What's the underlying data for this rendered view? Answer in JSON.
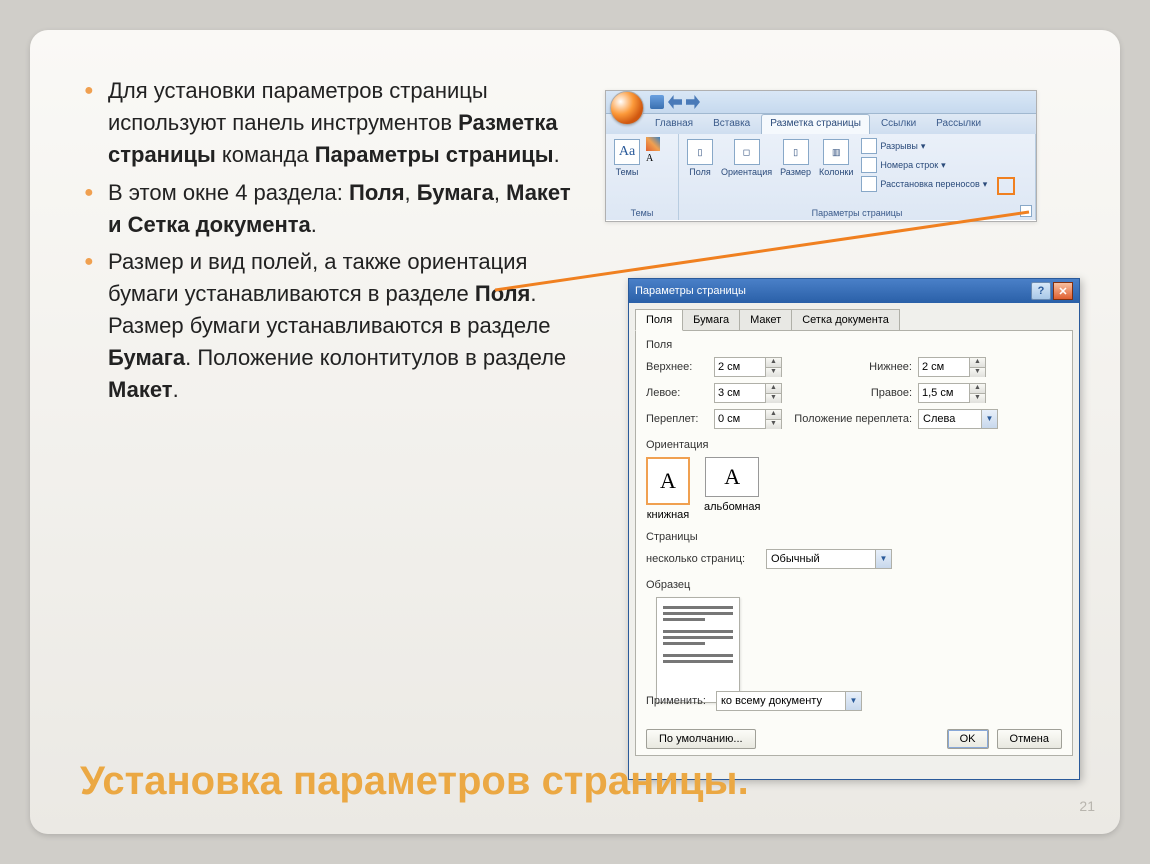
{
  "slide": {
    "bullets": [
      {
        "pre": "Для установки параметров страницы используют панель инструментов ",
        "b1": "Разметка страницы",
        "mid": " команда ",
        "b2": "Параметры страницы",
        "post": "."
      },
      {
        "pre": "В этом окне 4 раздела: ",
        "b1": "Поля",
        "mid": ", ",
        "b2": "Бумага",
        "mid2": ", ",
        "b3": "Макет и Сетка документа",
        "post": "."
      },
      {
        "pre": "Размер и вид полей, а также ориентация бумаги устанавливаются в разделе ",
        "b1": "Поля",
        "mid": ". Размер бумаги устанавливаются в разделе ",
        "b2": "Бумага",
        "mid2": ". Положение колонтитулов в разделе ",
        "b3": "Макет",
        "post": "."
      }
    ],
    "title": "Установка параметров страницы.",
    "page": "21"
  },
  "ribbon": {
    "tabs": [
      "Главная",
      "Вставка",
      "Разметка страницы",
      "Ссылки",
      "Рассылки"
    ],
    "active_tab": "Разметка страницы",
    "groups": {
      "themes": {
        "label": "Темы",
        "btn": "Темы"
      },
      "page_setup": {
        "label": "Параметры страницы",
        "margins": "Поля",
        "orientation": "Ориентация",
        "size": "Размер",
        "columns": "Колонки",
        "breaks": "Разрывы",
        "line_numbers": "Номера строк",
        "hyphenation": "Расстановка переносов"
      }
    }
  },
  "dialog": {
    "title": "Параметры страницы",
    "tabs": [
      "Поля",
      "Бумага",
      "Макет",
      "Сетка документа"
    ],
    "active_tab": "Поля",
    "sections": {
      "margins": {
        "label": "Поля",
        "top": {
          "label": "Верхнее:",
          "value": "2 см"
        },
        "bottom": {
          "label": "Нижнее:",
          "value": "2 см"
        },
        "left": {
          "label": "Левое:",
          "value": "3 см"
        },
        "right": {
          "label": "Правое:",
          "value": "1,5 см"
        },
        "gutter": {
          "label": "Переплет:",
          "value": "0 см"
        },
        "gutter_pos": {
          "label": "Положение переплета:",
          "value": "Слева"
        }
      },
      "orientation": {
        "label": "Ориентация",
        "portrait": "книжная",
        "landscape": "альбомная"
      },
      "pages": {
        "label": "Страницы",
        "multi": {
          "label": "несколько страниц:",
          "value": "Обычный"
        }
      },
      "preview": {
        "label": "Образец"
      },
      "apply": {
        "label": "Применить:",
        "value": "ко всему документу"
      }
    },
    "buttons": {
      "default": "По умолчанию...",
      "ok": "OK",
      "cancel": "Отмена"
    }
  }
}
